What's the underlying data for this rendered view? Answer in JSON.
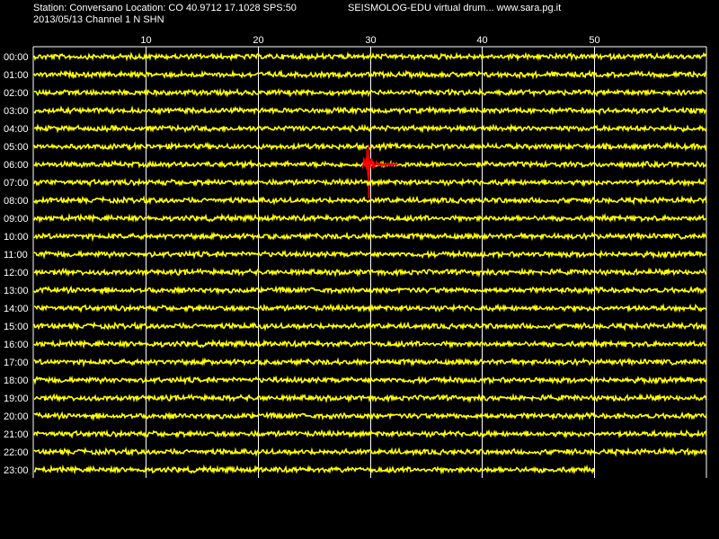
{
  "header": {
    "station_line": "Station: Conversano Location: CO 40.9712 17.1028 SPS:50",
    "date_line": "2013/05/13  Channel 1 N SHN",
    "brand_line": "SEISMOLOG-EDU virtual drum... www.sara.pg.it"
  },
  "colors": {
    "background": "#000000",
    "trace": "#ffff00",
    "event": "#ff0000",
    "grid": "#ffffff",
    "text": "#ffffff"
  },
  "chart_data": {
    "type": "line",
    "title": "",
    "xlabel": "",
    "ylabel": "",
    "x_unit": "minutes",
    "xlim": [
      0,
      60
    ],
    "x_ticks": [
      10,
      20,
      30,
      40,
      50
    ],
    "hours": [
      "00:00",
      "01:00",
      "02:00",
      "03:00",
      "04:00",
      "05:00",
      "06:00",
      "07:00",
      "08:00",
      "09:00",
      "10:00",
      "11:00",
      "12:00",
      "13:00",
      "14:00",
      "15:00",
      "16:00",
      "17:00",
      "18:00",
      "19:00",
      "20:00",
      "21:00",
      "22:00",
      "23:00"
    ],
    "trace_color": "#ffff00",
    "last_hour_end_minute": 50,
    "event": {
      "hour": "06:00",
      "start_minute": 29.5,
      "end_minute": 32,
      "color": "#ff0000"
    }
  }
}
